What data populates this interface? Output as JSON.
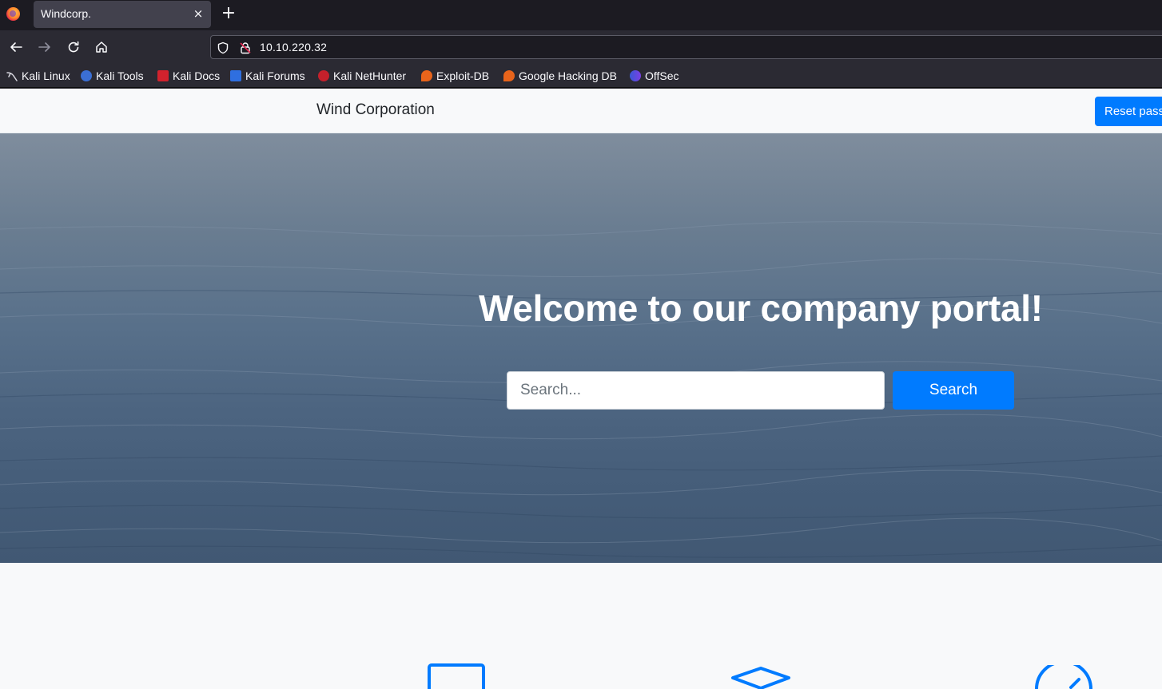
{
  "browser": {
    "tab_title": "Windcorp.",
    "tab_close": "×",
    "new_tab": "+",
    "url": "10.10.220.32",
    "bookmarks": [
      {
        "label": "Kali Linux",
        "icon": "kali-dragon-icon"
      },
      {
        "label": "Kali Tools",
        "icon": "kali-tools-icon"
      },
      {
        "label": "Kali Docs",
        "icon": "kali-docs-icon"
      },
      {
        "label": "Kali Forums",
        "icon": "kali-forums-icon"
      },
      {
        "label": "Kali NetHunter",
        "icon": "nethunter-icon"
      },
      {
        "label": "Exploit-DB",
        "icon": "exploit-db-icon"
      },
      {
        "label": "Google Hacking DB",
        "icon": "ghdb-icon"
      },
      {
        "label": "OffSec",
        "icon": "offsec-icon"
      }
    ]
  },
  "site": {
    "brand": "Wind Corporation",
    "reset_button": "Reset password"
  },
  "hero": {
    "title": "Welcome to our company portal!",
    "search_placeholder": "Search...",
    "search_button": "Search"
  },
  "colors": {
    "accent": "#007bff",
    "page_bg": "#f8f9fa"
  }
}
